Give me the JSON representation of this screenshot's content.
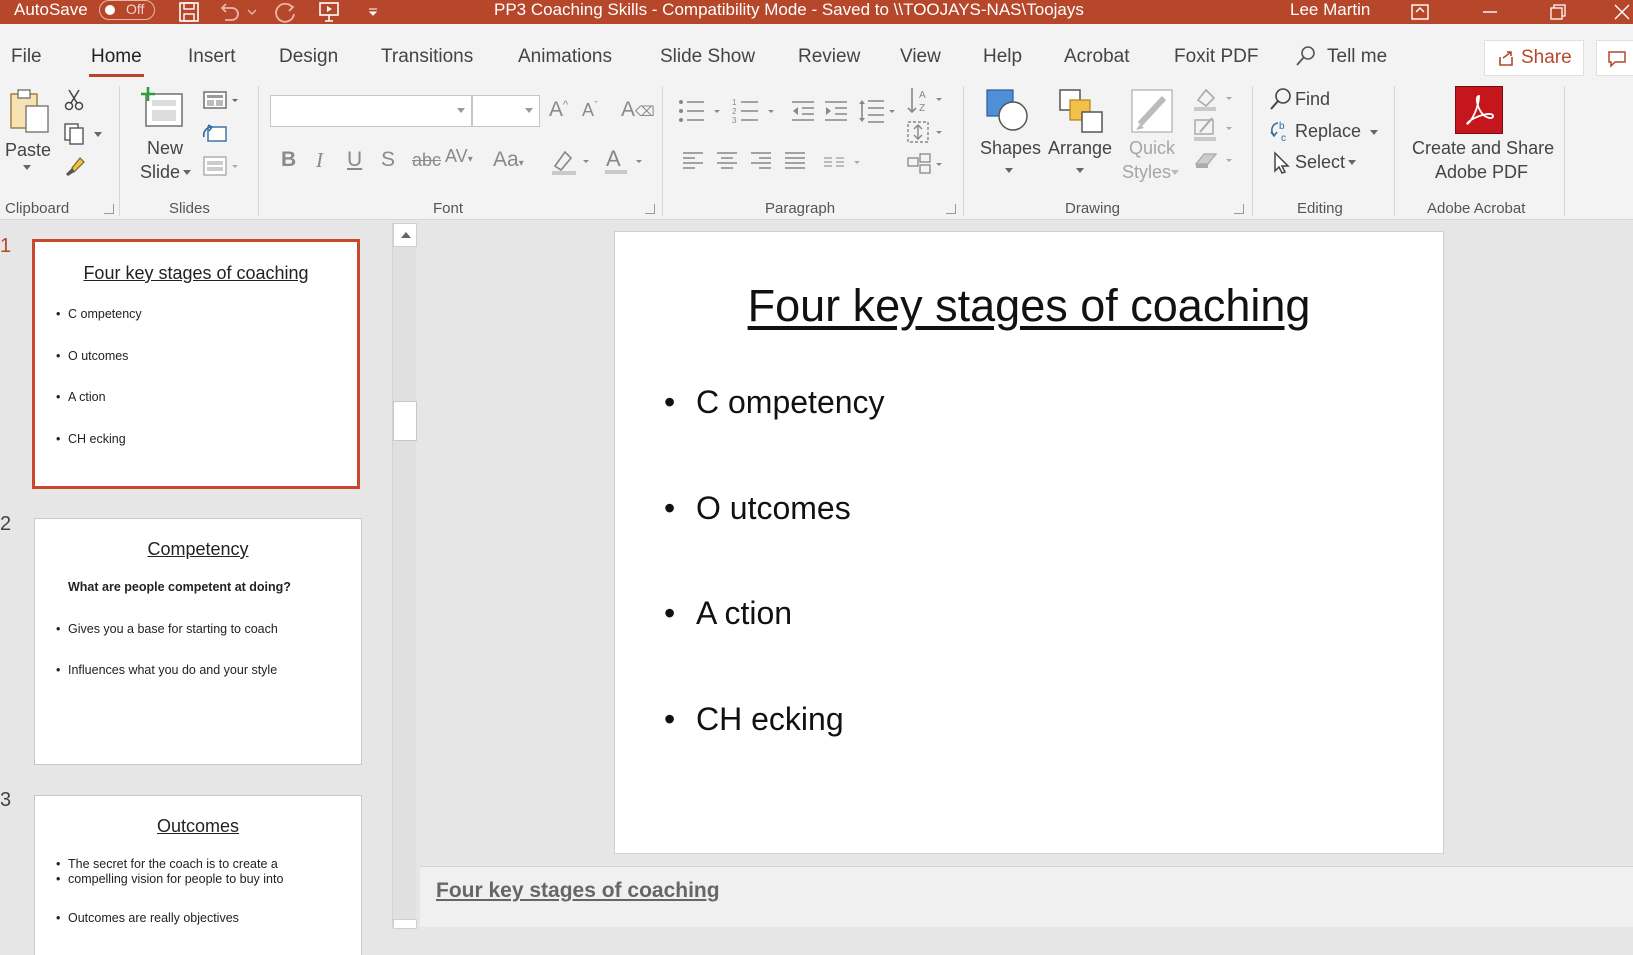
{
  "window": {
    "autosave_label": "AutoSave",
    "autosave_state": "Off",
    "title": "PP3 Coaching Skills  -  Compatibility Mode  -  Saved to \\\\TOOJAYS-NAS\\Toojays",
    "user": "Lee Martin"
  },
  "tabs": [
    {
      "label": "File"
    },
    {
      "label": "Home"
    },
    {
      "label": "Insert"
    },
    {
      "label": "Design"
    },
    {
      "label": "Transitions"
    },
    {
      "label": "Animations"
    },
    {
      "label": "Slide Show"
    },
    {
      "label": "Review"
    },
    {
      "label": "View"
    },
    {
      "label": "Help"
    },
    {
      "label": "Acrobat"
    },
    {
      "label": "Foxit PDF"
    },
    {
      "label": "Tell me"
    }
  ],
  "share_label": "Share",
  "ribbon": {
    "groups": {
      "clipboard": "Clipboard",
      "slides": "Slides",
      "font": "Font",
      "paragraph": "Paragraph",
      "drawing": "Drawing",
      "editing": "Editing",
      "adobe": "Adobe Acrobat"
    },
    "paste": "Paste",
    "new_slide_1": "New",
    "new_slide_2": "Slide",
    "shapes": "Shapes",
    "arrange": "Arrange",
    "quick_styles_1": "Quick",
    "quick_styles_2": "Styles",
    "find": "Find",
    "replace": "Replace",
    "select": "Select",
    "adobe_1": "Create and Share",
    "adobe_2": "Adobe PDF"
  },
  "thumbnails": [
    {
      "num": "1",
      "title": "Four key stages of coaching",
      "bullets": [
        "C ompetency",
        "O utcomes",
        "A ction",
        "CH ecking"
      ]
    },
    {
      "num": "2",
      "title": "Competency",
      "subtitle": "What are people competent at doing?",
      "bullets": [
        "Gives you a base for starting to coach",
        "Influences what you do and your style"
      ]
    },
    {
      "num": "3",
      "title": "Outcomes",
      "bullets": [
        "The secret for the coach is to create a",
        "compelling vision for people to buy into",
        "Outcomes are really objectives"
      ]
    }
  ],
  "slide": {
    "title": "Four key stages of coaching",
    "bullets": [
      "C ompetency",
      "O utcomes",
      "A ction",
      "CH ecking"
    ]
  },
  "notes": "Four key stages of coaching",
  "colors": {
    "accent": "#b7472a",
    "adobe": "#c4161c"
  }
}
